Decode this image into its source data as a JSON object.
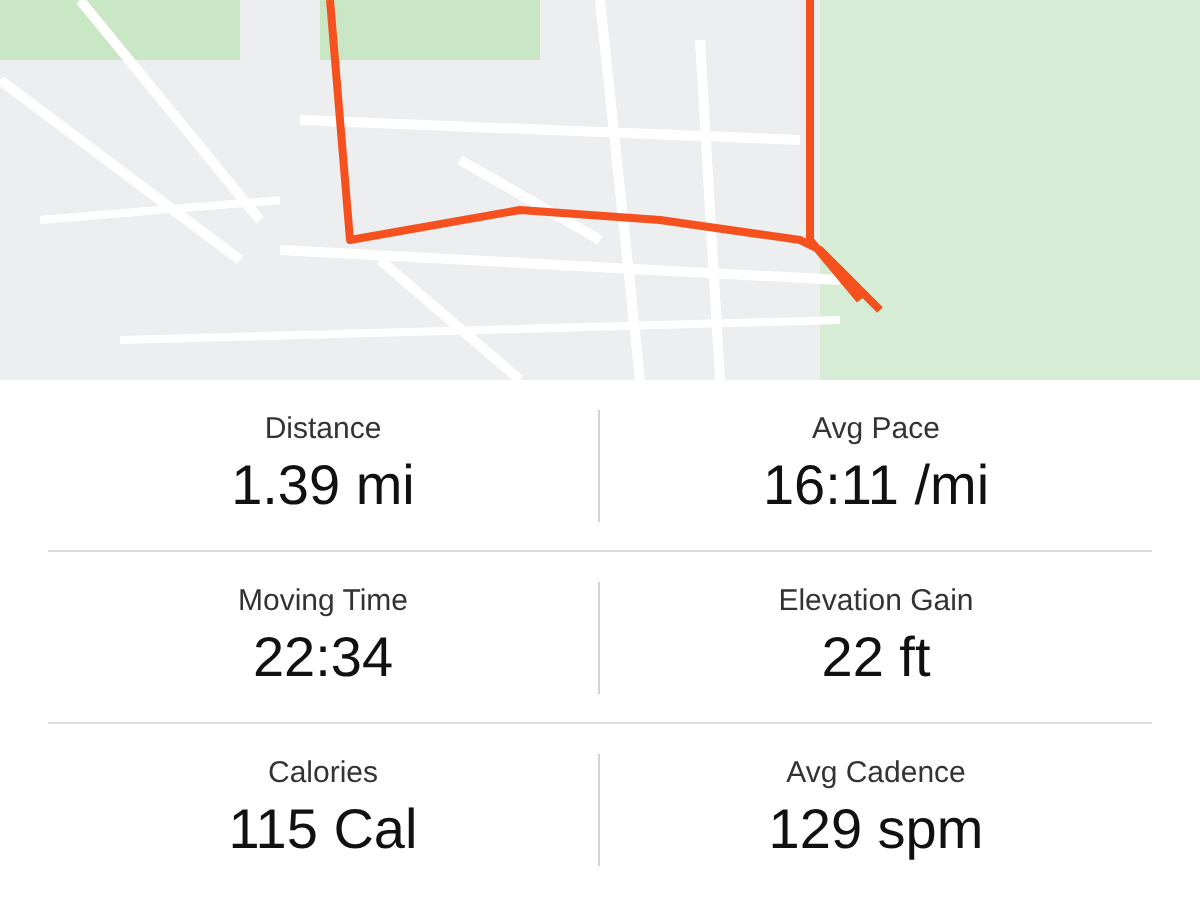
{
  "stats": [
    {
      "label": "Distance",
      "value": "1.39 mi"
    },
    {
      "label": "Avg Pace",
      "value": "16:11 /mi"
    },
    {
      "label": "Moving Time",
      "value": "22:34"
    },
    {
      "label": "Elevation Gain",
      "value": "22 ft"
    },
    {
      "label": "Calories",
      "value": "115 Cal"
    },
    {
      "label": "Avg Cadence",
      "value": "129 spm"
    }
  ]
}
